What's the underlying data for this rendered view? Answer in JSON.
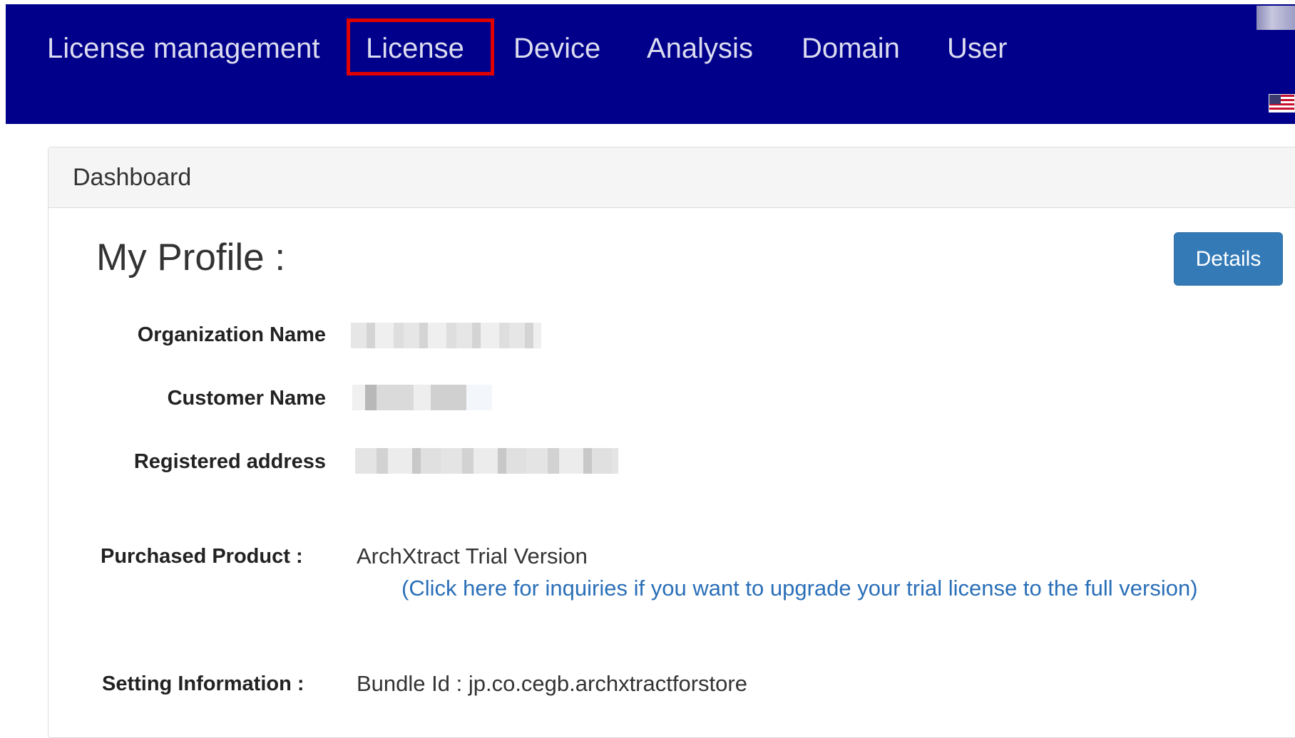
{
  "nav": {
    "brand": "License management",
    "items": [
      "License",
      "Device",
      "Analysis",
      "Domain",
      "User"
    ],
    "active_item": "License"
  },
  "panel": {
    "heading": "Dashboard"
  },
  "profile": {
    "title": "My Profile :",
    "details_button": "Details",
    "fields": [
      {
        "label": "Organization Name",
        "value": ""
      },
      {
        "label": "Customer Name",
        "value": ""
      },
      {
        "label": "Registered address",
        "value": ""
      }
    ]
  },
  "purchased": {
    "label": "Purchased Product :",
    "product": "ArchXtract Trial Version",
    "upgrade_link": "(Click here for inquiries if you want to upgrade your trial license to the full version)"
  },
  "settings": {
    "label": "Setting Information :",
    "bundle_id": "Bundle Id : jp.co.cegb.archxtractforstore"
  },
  "colors": {
    "navbar_bg": "#00008b",
    "highlight_border": "#e00000",
    "button_bg": "#337ab7",
    "link": "#2a6fb8"
  },
  "icons": {
    "language_flag": "us-flag-icon"
  }
}
